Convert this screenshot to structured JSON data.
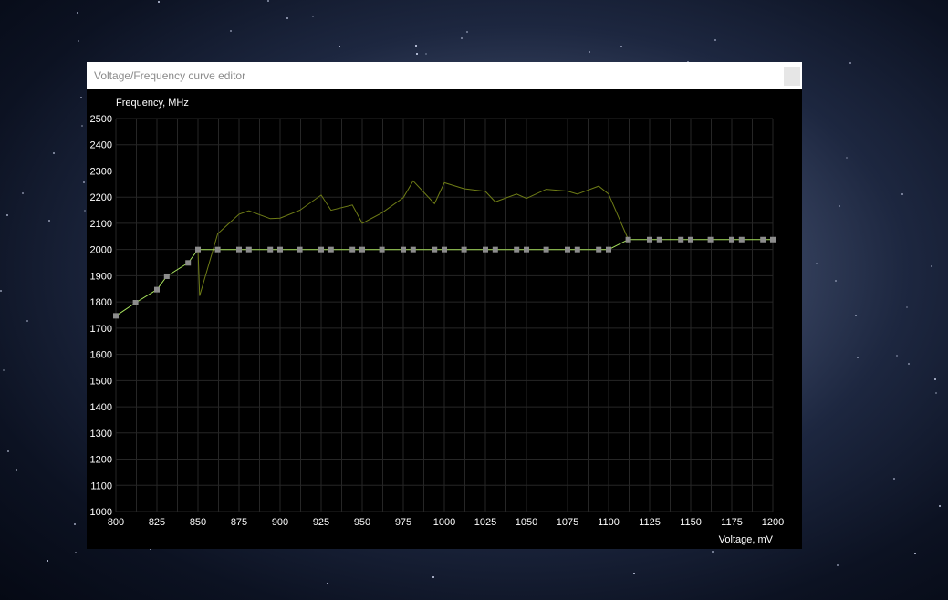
{
  "window": {
    "title": "Voltage/Frequency curve editor"
  },
  "chart_data": {
    "type": "line",
    "ylabel": "Frequency, MHz",
    "xlabel": "Voltage, mV",
    "xlim": [
      800,
      1200
    ],
    "ylim": [
      1000,
      2500
    ],
    "x_ticks": [
      800,
      825,
      850,
      875,
      900,
      925,
      950,
      975,
      1000,
      1025,
      1050,
      1075,
      1100,
      1125,
      1150,
      1175,
      1200
    ],
    "y_ticks": [
      1000,
      1100,
      1200,
      1300,
      1400,
      1500,
      1600,
      1700,
      1800,
      1900,
      2000,
      2100,
      2200,
      2300,
      2400,
      2500
    ],
    "grid": true,
    "series": [
      {
        "color": "#a6e05c",
        "markers": true,
        "x": [
          800,
          812,
          825,
          831,
          844,
          850,
          862,
          875,
          881,
          894,
          900,
          912,
          925,
          931,
          944,
          950,
          962,
          975,
          981,
          994,
          1000,
          1012,
          1025,
          1031,
          1044,
          1050,
          1062,
          1075,
          1081,
          1094,
          1100,
          1112,
          1125,
          1131,
          1144,
          1150,
          1162,
          1175,
          1181,
          1194,
          1200
        ],
        "y": [
          1747,
          1797,
          1847,
          1898,
          1949,
          2000,
          2000,
          2000,
          2000,
          2000,
          2000,
          2000,
          2000,
          2000,
          2000,
          2000,
          2000,
          2000,
          2000,
          2000,
          2000,
          2000,
          2000,
          2000,
          2000,
          2000,
          2000,
          2000,
          2000,
          2000,
          2000,
          2038,
          2038,
          2038,
          2038,
          2038,
          2038,
          2038,
          2038,
          2038,
          2038
        ]
      },
      {
        "color": "#6f7d16",
        "markers": false,
        "x": [
          850,
          851,
          862,
          875,
          881,
          894,
          900,
          912,
          925,
          931,
          944,
          950,
          962,
          975,
          981,
          994,
          1000,
          1012,
          1025,
          1031,
          1044,
          1050,
          1062,
          1075,
          1081,
          1094,
          1100,
          1112
        ],
        "y": [
          2000,
          1823,
          2060,
          2135,
          2148,
          2118,
          2120,
          2150,
          2208,
          2150,
          2170,
          2100,
          2140,
          2198,
          2262,
          2175,
          2255,
          2232,
          2222,
          2182,
          2212,
          2195,
          2230,
          2223,
          2212,
          2242,
          2212,
          2038
        ]
      }
    ]
  }
}
